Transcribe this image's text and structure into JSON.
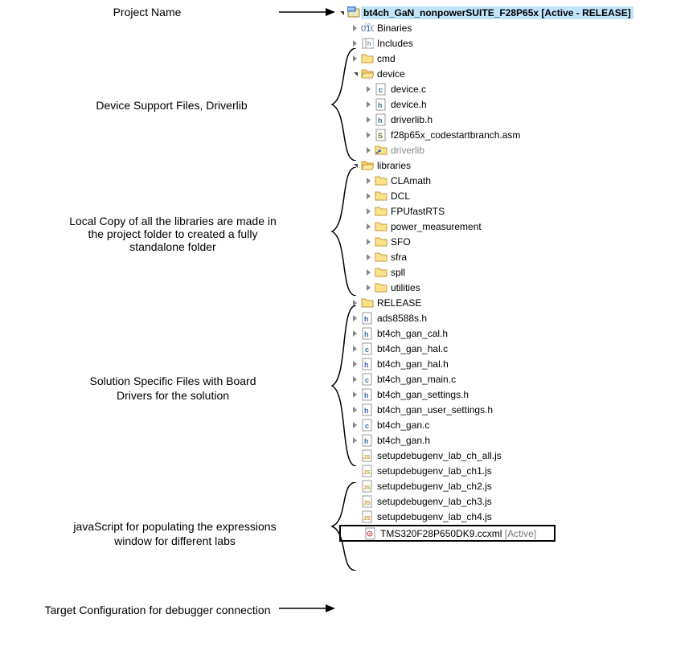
{
  "annotations": {
    "projectName": "Project Name",
    "deviceSupport": "Device Support Files, Driverlib",
    "localCopy": "Local Copy of all the libraries are made in the project folder to created a fully standalone folder",
    "solutionFiles": "Solution Specific Files with Board Drivers for the solution",
    "javascript": "javaScript for populating the expressions window for different labs",
    "targetConfig": "Target Configuration for debugger connection"
  },
  "project": {
    "name": "bt4ch_GaN_nonpowerSUITE_F28P65x",
    "status": " [Active - RELEASE]"
  },
  "tree": {
    "binaries": "Binaries",
    "includes": "Includes",
    "cmd": "cmd",
    "device": "device",
    "device_c": "device.c",
    "device_h": "device.h",
    "driverlib_h": "driverlib.h",
    "f28p65x_asm": "f28p65x_codestartbranch.asm",
    "driverlib_folder": "driverlib",
    "libraries": "libraries",
    "clamath": "CLAmath",
    "dcl": "DCL",
    "fpufastrts": "FPUfastRTS",
    "power_meas": "power_measurement",
    "sfo": "SFO",
    "sfra": "sfra",
    "spll": "spll",
    "utilities": "utilities",
    "release": "RELEASE",
    "ads8588s": "ads8588s.h",
    "gan_cal_h": "bt4ch_gan_cal.h",
    "gan_hal_c": "bt4ch_gan_hal.c",
    "gan_hal_h": "bt4ch_gan_hal.h",
    "gan_main_c": "bt4ch_gan_main.c",
    "gan_settings_h": "bt4ch_gan_settings.h",
    "gan_user_h": "bt4ch_gan_user_settings.h",
    "gan_c": "bt4ch_gan.c",
    "gan_h": "bt4ch_gan.h",
    "js_all": "setupdebugenv_lab_ch_all.js",
    "js_ch1": "setupdebugenv_lab_ch1.js",
    "js_ch2": "setupdebugenv_lab_ch2.js",
    "js_ch3": "setupdebugenv_lab_ch3.js",
    "js_ch4": "setupdebugenv_lab_ch4.js",
    "ccxml": "TMS320F28P650DK9.ccxml",
    "ccxml_suffix": " [Active]"
  }
}
